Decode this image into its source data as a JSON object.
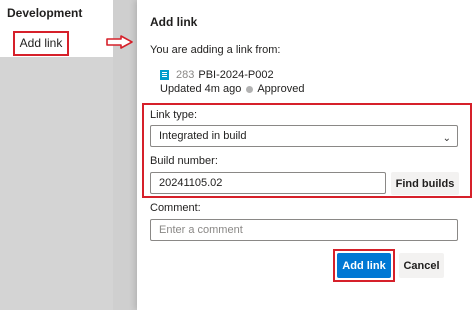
{
  "sidebar": {
    "section_title": "Development",
    "add_link_label": "Add link"
  },
  "dialog": {
    "title": "Add link",
    "source_intro": "You are adding a link from:",
    "work_item": {
      "icon": "work-item-icon",
      "id": "283",
      "title": "PBI-2024-P002",
      "updated": "Updated 4m ago",
      "status": "Approved",
      "status_color": "#b2b2b2"
    },
    "link_type": {
      "label": "Link type:",
      "value": "Integrated in build"
    },
    "build_number": {
      "label": "Build number:",
      "value": "20241105.02",
      "find_button": "Find builds"
    },
    "comment": {
      "label": "Comment:",
      "placeholder": "Enter a comment"
    },
    "actions": {
      "primary": "Add link",
      "cancel": "Cancel"
    }
  },
  "colors": {
    "accent": "#0078d4",
    "annotation": "#d6202a"
  }
}
